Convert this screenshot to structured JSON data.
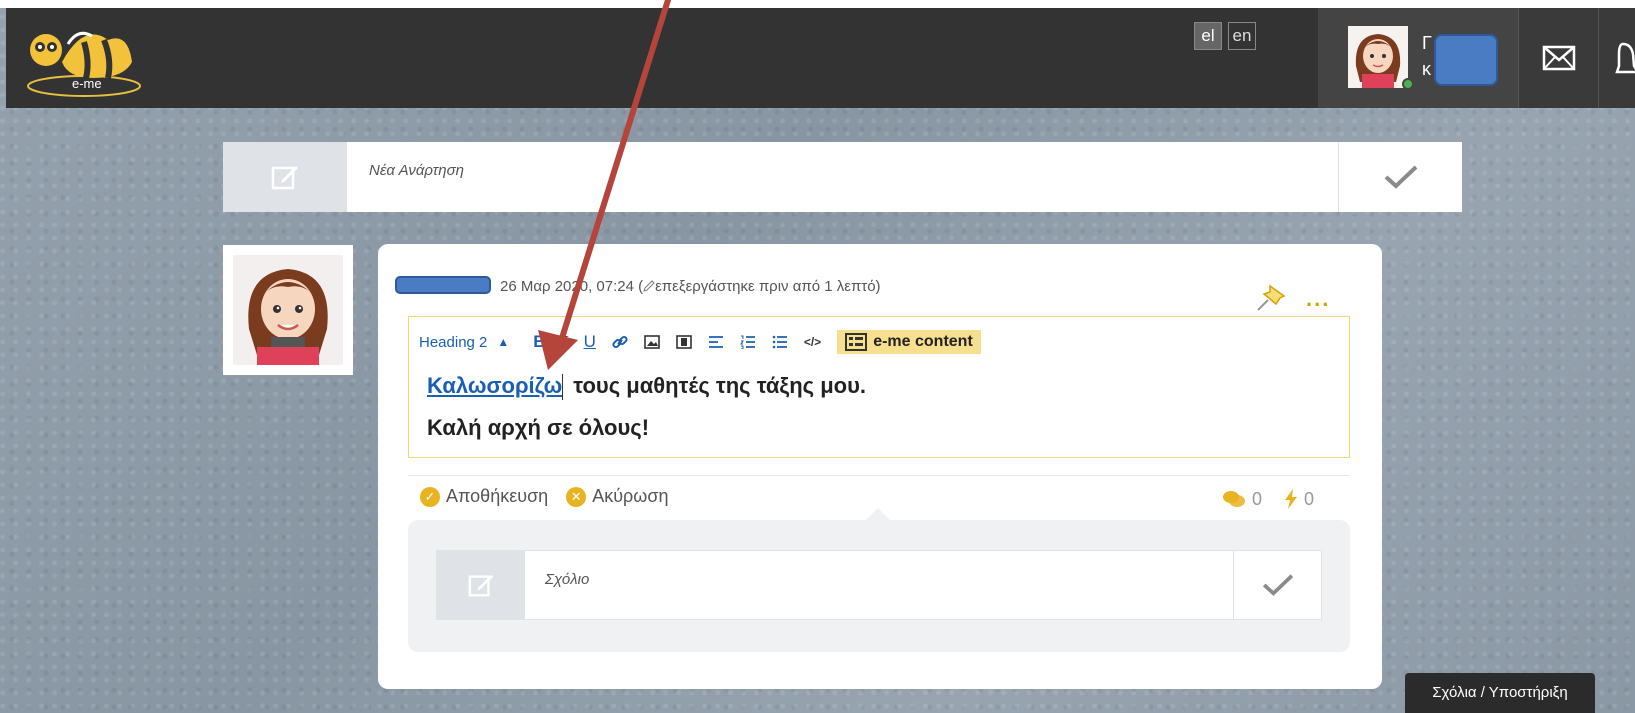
{
  "header": {
    "logo_text": "e-me",
    "languages": [
      {
        "code": "el",
        "active": true
      },
      {
        "code": "en",
        "active": false
      }
    ],
    "user": {
      "name_line1": "Γ",
      "name_line2": "κ"
    },
    "icons": {
      "mail": "envelope-icon",
      "notifications": "bell-icon"
    }
  },
  "new_post": {
    "placeholder": "Νέα Ανάρτηση",
    "icon": "edit-icon",
    "submit_icon": "check-icon"
  },
  "post": {
    "date": "26 Μαρ 2020, 07:24 (",
    "edited": "επεξεργάστηκε πριν από 1 λεπτό)",
    "more_label": "...",
    "toolbar": {
      "heading_select": "Heading 2",
      "bold": "B",
      "italic": "I",
      "underline": "U",
      "code": "</>",
      "eme_content": "e-me content"
    },
    "content": {
      "link_word": "Καλωσορίζω",
      "line1_rest": " τους μαθητές της τάξης μου.",
      "line2": "Καλή αρχή σε όλους!"
    },
    "actions": {
      "save": "Αποθήκευση",
      "cancel": "Ακύρωση"
    },
    "stats": {
      "comments": "0",
      "likes": "0"
    }
  },
  "comment": {
    "placeholder": "Σχόλιο"
  },
  "feedback": {
    "label": "Σχόλια / Υποστήριξη"
  },
  "colors": {
    "topbar": "#333333",
    "accent_gold": "#e8b320",
    "link_blue": "#1b5fb3",
    "arrow_red": "#b5443b",
    "eme_button": "#f6df8e"
  }
}
